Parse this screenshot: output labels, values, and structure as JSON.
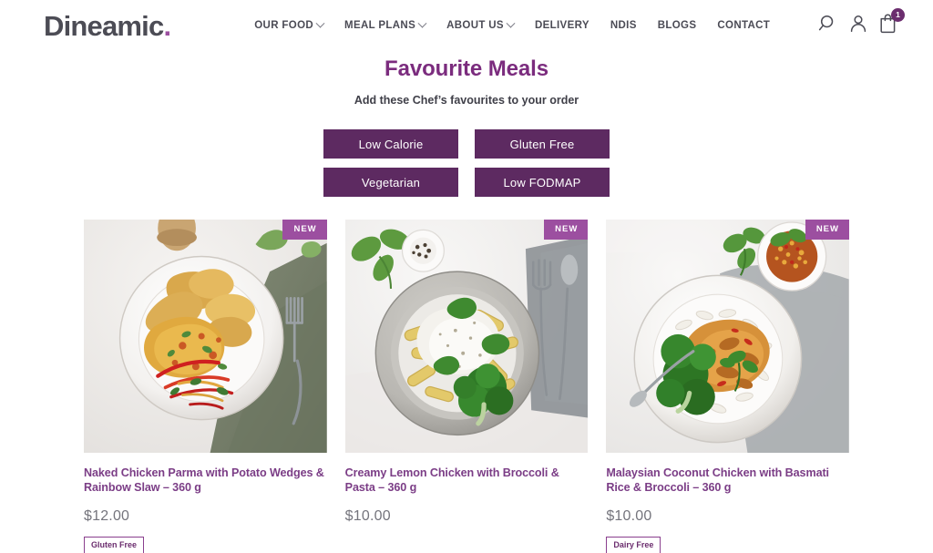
{
  "header": {
    "logo_text": "Dineamic",
    "logo_dot": ".",
    "nav": [
      {
        "label": "OUR FOOD",
        "has_dropdown": true
      },
      {
        "label": "MEAL PLANS",
        "has_dropdown": true
      },
      {
        "label": "ABOUT US",
        "has_dropdown": true
      },
      {
        "label": "DELIVERY",
        "has_dropdown": false
      },
      {
        "label": "NDIS",
        "has_dropdown": false
      },
      {
        "label": "BLOGS",
        "has_dropdown": false
      },
      {
        "label": "CONTACT",
        "has_dropdown": false
      }
    ],
    "icons": {
      "search": "search-icon",
      "account": "user-account-icon",
      "cart": "shopping-bag-icon",
      "cart_count": "1"
    }
  },
  "main": {
    "title": "Favourite Meals",
    "subtitle": "Add these Chef’s favourites to your order",
    "filters": [
      {
        "label": "Low Calorie"
      },
      {
        "label": "Gluten Free"
      },
      {
        "label": "Vegetarian"
      },
      {
        "label": "Low FODMAP"
      }
    ],
    "products": [
      {
        "badge": "NEW",
        "title": "Naked Chicken Parma with Potato Wedges & Rainbow Slaw – 360 g",
        "price": "$12.00",
        "tags": [
          "Gluten Free"
        ]
      },
      {
        "badge": "NEW",
        "title": "Creamy Lemon Chicken with Broccoli & Pasta – 360 g",
        "price": "$10.00",
        "tags": []
      },
      {
        "badge": "NEW",
        "title": "Malaysian Coconut Chicken with Basmati Rice & Broccoli – 360 g",
        "price": "$10.00",
        "tags": [
          "Dairy Free"
        ]
      }
    ]
  },
  "colors": {
    "brand_purple": "#7b2c7e",
    "button_purple": "#5d2a61",
    "badge_purple": "#9c4fa0",
    "nav_text": "#4b4b55",
    "price_gray": "#74747c"
  }
}
